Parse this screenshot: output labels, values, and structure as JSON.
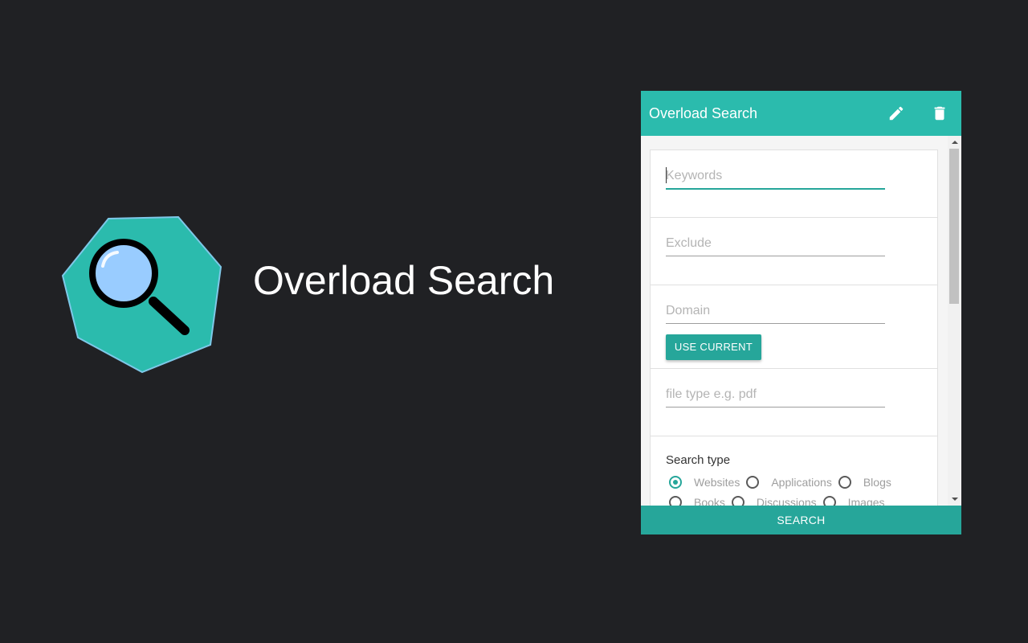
{
  "brand": {
    "title": "Overload Search",
    "logo_icon": "magnifier-heptagon-icon",
    "logo_fill": "#2bbbad",
    "logo_border": "#7ec8e8",
    "lens_fill": "#99ccff"
  },
  "popup": {
    "title": "Overload Search",
    "edit_icon": "pencil-icon",
    "delete_icon": "trash-icon",
    "header_color": "#2bbbad",
    "accent_color": "#26a69a",
    "fields": {
      "keywords_placeholder": "Keywords",
      "keywords_value": "",
      "exclude_placeholder": "Exclude",
      "exclude_value": "",
      "domain_placeholder": "Domain",
      "domain_value": "",
      "filetype_placeholder": "file type e.g. pdf",
      "filetype_value": ""
    },
    "use_current_label": "USE CURRENT",
    "search_type": {
      "label": "Search type",
      "selected": "Websites",
      "options_row1": [
        "Websites",
        "Applications",
        "Blogs"
      ],
      "options_row2": [
        "Books",
        "Discussions",
        "Images"
      ]
    },
    "search_label": "SEARCH"
  }
}
